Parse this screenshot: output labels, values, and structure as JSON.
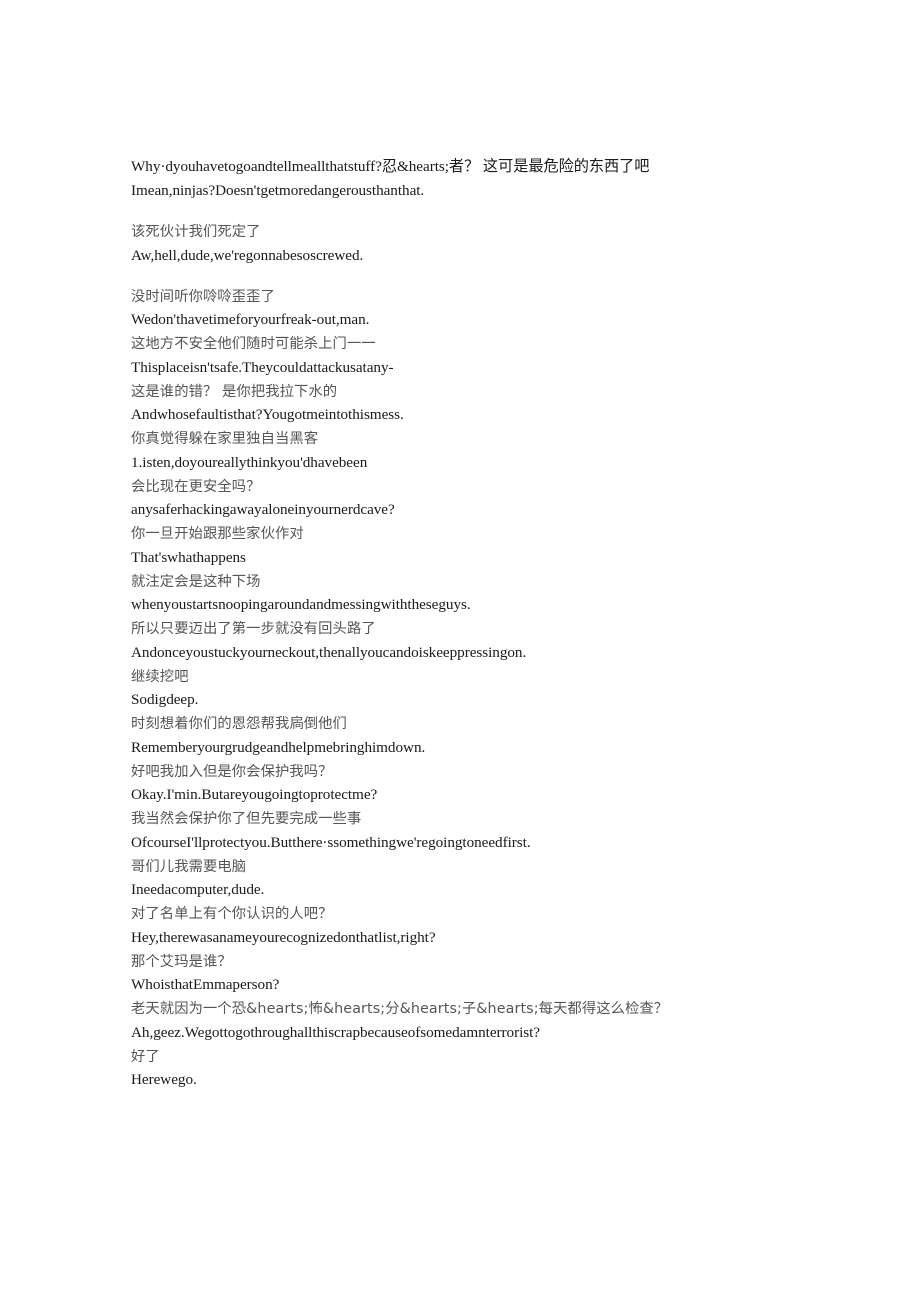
{
  "document": {
    "type": "bilingual-dialogue-transcript",
    "page_background": "#ffffff",
    "chinese_text_color": "#555555",
    "english_text_color": "#1a1a1a",
    "blocks": [
      {
        "en_first": "Why·dyouhavetogoandtellmeallthatstuff?忍&hearts;者？ 这可是最危险的东西了吧",
        "en_second": "Imean,ninjas?Doesn'tgetmoredangerousthanthat."
      },
      {
        "zh": "该死伙计我们死定了",
        "en": "Aw,hell,dude,we'regonnabesoscrewed."
      },
      {
        "zh": "没时间听你唥唥歪歪了",
        "en": "Wedon'thavetimeforyourfreak-out,man."
      },
      {
        "zh": "这地方不安全他们随时可能杀上门一一",
        "en": "Thisplaceisn'tsafe.Theycouldattackusatany-"
      },
      {
        "zh": "这是谁的错？ 是你把我拉下水的",
        "en": "Andwhosefaultisthat?Yougotmeintothismess."
      },
      {
        "zh": "你真觉得躲在家里独自当黑客",
        "en": "1.isten,doyoureallythinkyou'dhavebeen"
      },
      {
        "zh": "会比现在更安全吗？",
        "en": "anysaferhackingawayaloneinyournerdcave?"
      },
      {
        "zh": "你一旦开始跟那些家伙作对",
        "en": "That'swhathappens"
      },
      {
        "zh": "就注定会是这种下场",
        "en": "whenyoustartsnoopingaroundandmessingwiththeseguys."
      },
      {
        "zh": "所以只要迈出了第一步就没有回头路了",
        "en": "Andonceyoustuckyourneckout,thenallyoucandoiskeeppressingon."
      },
      {
        "zh": "继续挖吧",
        "en": "Sodigdeep."
      },
      {
        "zh": "时刻想着你们的恩怨帮我扄倒他们",
        "en": "Rememberyourgrudgeandhelpmebringhimdown."
      },
      {
        "zh": "好吧我加入但是你会保护我吗？",
        "en": "Okay.Ӏ'min.Butareyougoingtoprotectme?"
      },
      {
        "zh": "我当然会保护你了但先要完成一些事",
        "en": "OfcourseӀ'llprotectyou.Butthere·ssomethingwe'regoingtoneedfirst."
      },
      {
        "zh": "哥们儿我需要电脑",
        "en": "Ineedacomputer,dude."
      },
      {
        "zh": "对了名单上有个你认识的人吧？",
        "en": "Hey,therewasanameyourecognizedonthatlist,right?"
      },
      {
        "zh": "那个艾玛是谁？",
        "en": "WhoisthatEmmaperson?"
      },
      {
        "zh": "老天就因为一个恐&hearts;怖&hearts;分&hearts;子&hearts;每天都得这么检查？",
        "en": "Ah,geez.Wegottogothroughallthiscrapbecauseofsomedamnterrorist?"
      },
      {
        "zh": "好了",
        "en": "Herewego."
      }
    ]
  }
}
